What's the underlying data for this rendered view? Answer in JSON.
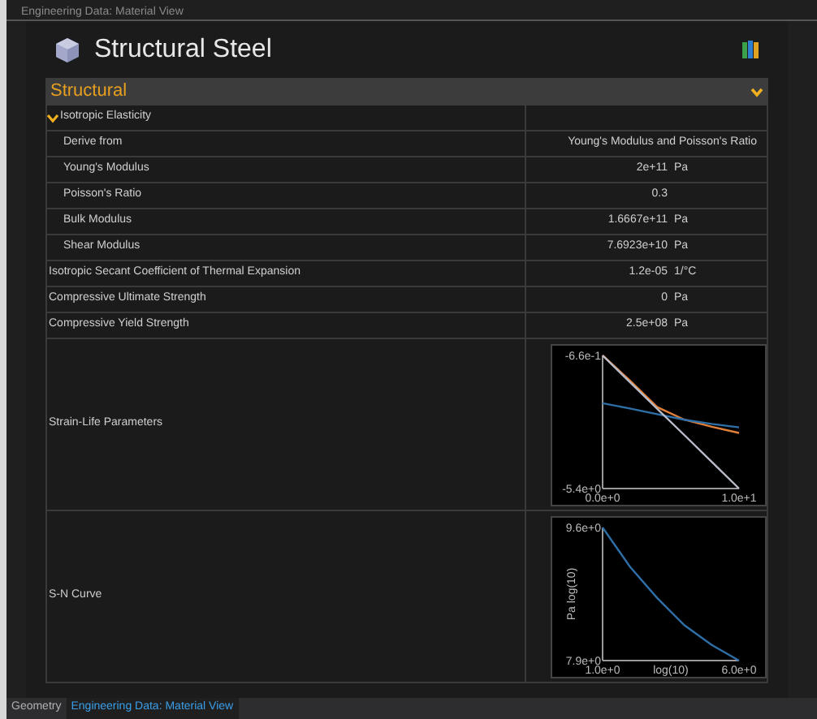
{
  "window": {
    "title": "Engineering Data: Material View"
  },
  "material": {
    "name": "Structural Steel"
  },
  "section": {
    "title": "Structural",
    "expanded": true
  },
  "rows": [
    {
      "kind": "group",
      "label": "Isotropic Elasticity",
      "expanded": true,
      "children": [
        {
          "kind": "prop",
          "label": "Derive from",
          "value": "Young's Modulus and Poisson's Ratio"
        },
        {
          "kind": "prop",
          "label": "Young's Modulus",
          "value": "2e+11",
          "unit": "Pa"
        },
        {
          "kind": "prop",
          "label": "Poisson's Ratio",
          "value": "0.3"
        },
        {
          "kind": "prop",
          "label": "Bulk Modulus",
          "value": "1.6667e+11",
          "unit": "Pa"
        },
        {
          "kind": "prop",
          "label": "Shear Modulus",
          "value": "7.6923e+10",
          "unit": "Pa"
        }
      ]
    },
    {
      "kind": "prop",
      "label": "Isotropic Secant Coefficient of Thermal Expansion",
      "value": "1.2e-05",
      "unit": "1/°C"
    },
    {
      "kind": "prop",
      "label": "Compressive Ultimate Strength",
      "value": "0",
      "unit": "Pa"
    },
    {
      "kind": "prop",
      "label": "Compressive Yield Strength",
      "value": "2.5e+08",
      "unit": "Pa"
    },
    {
      "kind": "chart",
      "label": "Strain-Life Parameters",
      "chart_data": {
        "type": "line",
        "x": [
          0,
          2,
          4,
          6,
          8,
          10
        ],
        "xlim": [
          0,
          10
        ],
        "ylim": [
          -5.4,
          -0.66
        ],
        "xticks": [
          {
            "value": 0,
            "label": "0.0e+0"
          },
          {
            "value": 10,
            "label": "1.0e+1"
          }
        ],
        "yticks": [
          {
            "value": -0.66,
            "label": "-6.6e-1"
          },
          {
            "value": -5.4,
            "label": "-5.4e+0"
          }
        ],
        "series": [
          {
            "color": "#e0803a",
            "values": [
              -0.66,
              -1.55,
              -2.5,
              -2.95,
              -3.2,
              -3.42
            ]
          },
          {
            "color": "#2f6fa8",
            "values": [
              -2.36,
              -2.55,
              -2.75,
              -2.95,
              -3.1,
              -3.22
            ]
          },
          {
            "color": "#b8bcc8",
            "values": [
              -0.66,
              -1.61,
              -2.56,
              -3.5,
              -4.45,
              -5.4
            ]
          }
        ]
      }
    },
    {
      "kind": "chart",
      "label": "S-N Curve",
      "chart_data": {
        "type": "line",
        "xlabel": "log(10)",
        "ylabel": "Pa log(10)",
        "x": [
          1,
          2,
          3,
          4,
          5,
          6
        ],
        "xlim": [
          1,
          6
        ],
        "ylim": [
          7.9,
          9.6
        ],
        "xticks": [
          {
            "value": 1,
            "label": "1.0e+0"
          },
          {
            "value": 6,
            "label": "6.0e+0"
          }
        ],
        "yticks": [
          {
            "value": 9.6,
            "label": "9.6e+0"
          },
          {
            "value": 7.9,
            "label": "7.9e+0"
          }
        ],
        "series": [
          {
            "color": "#2f6fa8",
            "values": [
              9.6,
              9.1,
              8.7,
              8.35,
              8.1,
              7.9
            ]
          }
        ]
      }
    }
  ],
  "tabs": [
    {
      "label": "Geometry",
      "selected": false
    },
    {
      "label": "Engineering Data: Material View",
      "selected": true
    }
  ]
}
